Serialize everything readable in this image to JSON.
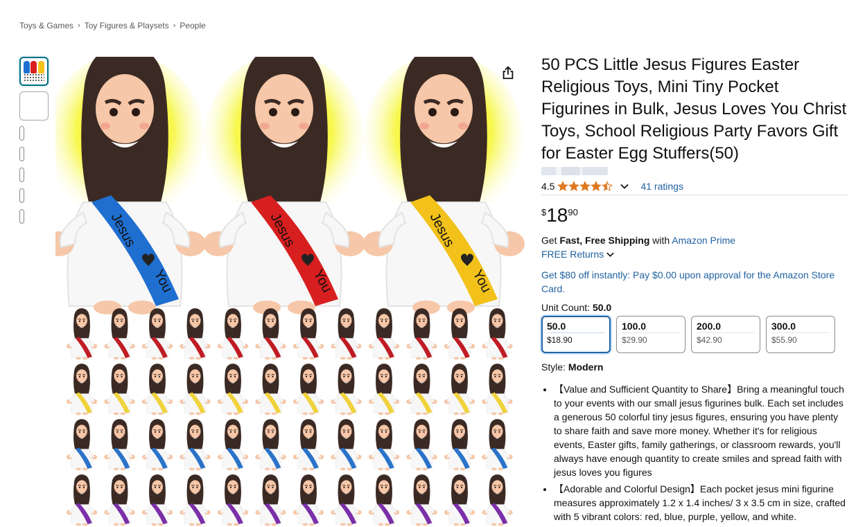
{
  "breadcrumb": [
    "Toys & Games",
    "Toy Figures & Playsets",
    "People"
  ],
  "breadcrumb_separator": "›",
  "product": {
    "title": "50 PCS Little Jesus Figures Easter Religious Toys, Mini Tiny Pocket Figurines in Bulk, Jesus Loves You Christ Toys, School Religious Party Favors Gift for Easter Egg Stuffers(50)",
    "rating_value": "4.5",
    "rating_stars": 4.5,
    "ratings_link": "41 ratings",
    "price_currency": "$",
    "price_whole": "18",
    "price_fraction": "90",
    "shipping_prefix": "Get ",
    "shipping_bold": "Fast, Free Shipping",
    "shipping_mid": " with ",
    "shipping_link": "Amazon Prime",
    "returns": "FREE Returns",
    "promo": "Get $80 off instantly: Pay $0.00 upon approval for the Amazon Store Card.",
    "unit_count_label": "Unit Count: ",
    "unit_count_value": "50.0",
    "options": [
      {
        "value": "50.0",
        "price": "$18.90"
      },
      {
        "value": "100.0",
        "price": "$29.90"
      },
      {
        "value": "200.0",
        "price": "$42.90"
      },
      {
        "value": "300.0",
        "price": "$55.90"
      }
    ],
    "selected_option": 0,
    "style_label": "Style: ",
    "style_value": "Modern",
    "bullets": [
      "【Value and Sufficient Quantity to Share】Bring a meaningful touch to your events with our small jesus figurines bulk. Each set includes a generous 50 colorful tiny jesus figures, ensuring you have plenty to share faith and save more money. Whether it's for religious events, Easter gifts, family gatherings, or classroom rewards, you'll always have enough quantity to create smiles and spread faith with jesus loves you figures",
      "【Adorable and Colorful Design】Each pocket jesus mini figurine measures approximately 1.2 x 1.4 inches/ 3 x 3.5 cm in size, crafted with 5 vibrant colors: red, blue, purple, yellow, and white."
    ]
  },
  "image": {
    "sash_text": "Jesus",
    "sash_text_2": "You",
    "large_figures": [
      {
        "sash_color": "#1f6fd0"
      },
      {
        "sash_color": "#d81f1f"
      },
      {
        "sash_color": "#f2c21b"
      }
    ],
    "small_rows": [
      {
        "sash_color": "#c01c24",
        "count": 12
      },
      {
        "sash_color": "#f0d23c",
        "count": 12
      },
      {
        "sash_color": "#2a73c9",
        "count": 12
      },
      {
        "sash_color": "#7b2fa8",
        "count": 12
      }
    ],
    "halo_color": "#f4f532",
    "hair_color": "#3b2a24",
    "skin_color": "#f6c7a8",
    "robe_color": "#f7f7f7"
  },
  "colors": {
    "link": "#2162a1",
    "star": "#de7921",
    "selected_border": "#2162a1"
  },
  "icons": {
    "share": "share-icon",
    "star": "star-icon",
    "chevron": "chevron-down-icon"
  },
  "thumbnail_count": 7
}
